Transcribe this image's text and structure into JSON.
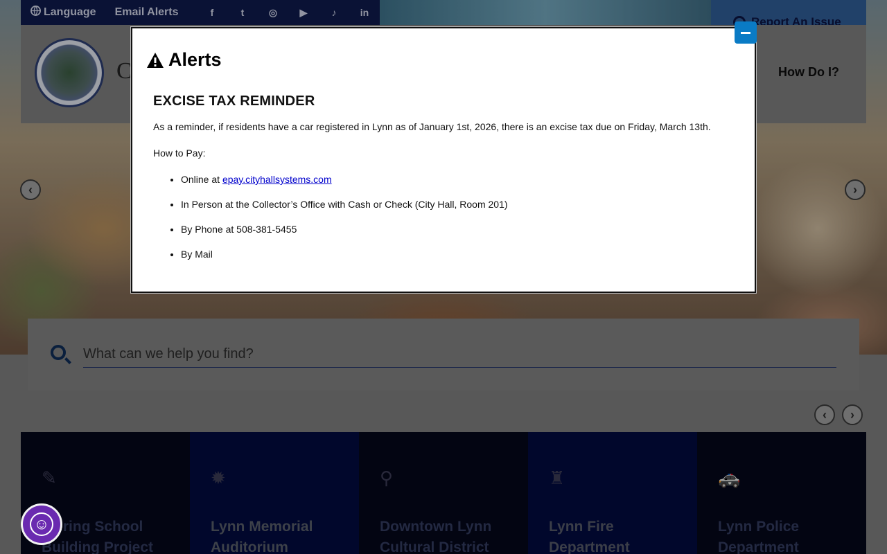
{
  "topbar": {
    "language_label": "Language",
    "email_alerts_label": "Email Alerts",
    "social": [
      {
        "icon": "facebook-icon",
        "glyph": "f"
      },
      {
        "icon": "twitter-icon",
        "glyph": "t"
      },
      {
        "icon": "instagram-icon",
        "glyph": "◎"
      },
      {
        "icon": "youtube-icon",
        "glyph": "▶"
      },
      {
        "icon": "tiktok-icon",
        "glyph": "♪"
      },
      {
        "icon": "linkedin-icon",
        "glyph": "in"
      }
    ]
  },
  "header": {
    "report_label": "Report An Issue",
    "city_initial": "C",
    "how_do_i_label": "How Do I?"
  },
  "hero": {
    "prev_glyph": "‹",
    "next_glyph": "›"
  },
  "search": {
    "placeholder": "What can we help you find?"
  },
  "cards_nav": {
    "prev_glyph": "‹",
    "next_glyph": "›"
  },
  "cards": [
    {
      "icon": "pencil-icon",
      "glyph": "✎",
      "title": "Pickering School Building Project"
    },
    {
      "icon": "badge-icon",
      "glyph": "✹",
      "title": "Lynn Memorial Auditorium"
    },
    {
      "icon": "map-pin-icon",
      "glyph": "⚲",
      "title": "Downtown Lynn Cultural District"
    },
    {
      "icon": "fire-extinguisher-icon",
      "glyph": "♜",
      "title": "Lynn Fire Department"
    },
    {
      "icon": "police-car-icon",
      "glyph": "🚓",
      "title": "Lynn Police Department"
    }
  ],
  "modal": {
    "heading": "Alerts",
    "alert_title": "EXCISE TAX REMINDER",
    "intro": "As a reminder, if residents have a car registered in Lynn as of January 1st, 2026, there is an excise tax due on Friday, March 13th.",
    "how_to_pay": "How to Pay:",
    "pay_online_prefix": "Online at ",
    "pay_online_link": "epay.cityhallsystems.com",
    "pay_in_person": "In Person at the Collector’s Office with Cash or Check (City Hall, Room 201)",
    "pay_phone": "By Phone at 508-381-5455",
    "pay_mail": "By Mail"
  },
  "accessibility": {
    "icon": "accessibility-icon",
    "glyph": "☺"
  },
  "colors": {
    "topbar_bg": "#0f1a4a",
    "modal_close_bg": "#0a7bc5",
    "link": "#0000cc",
    "accessibility_bg": "#6a2ab0"
  }
}
